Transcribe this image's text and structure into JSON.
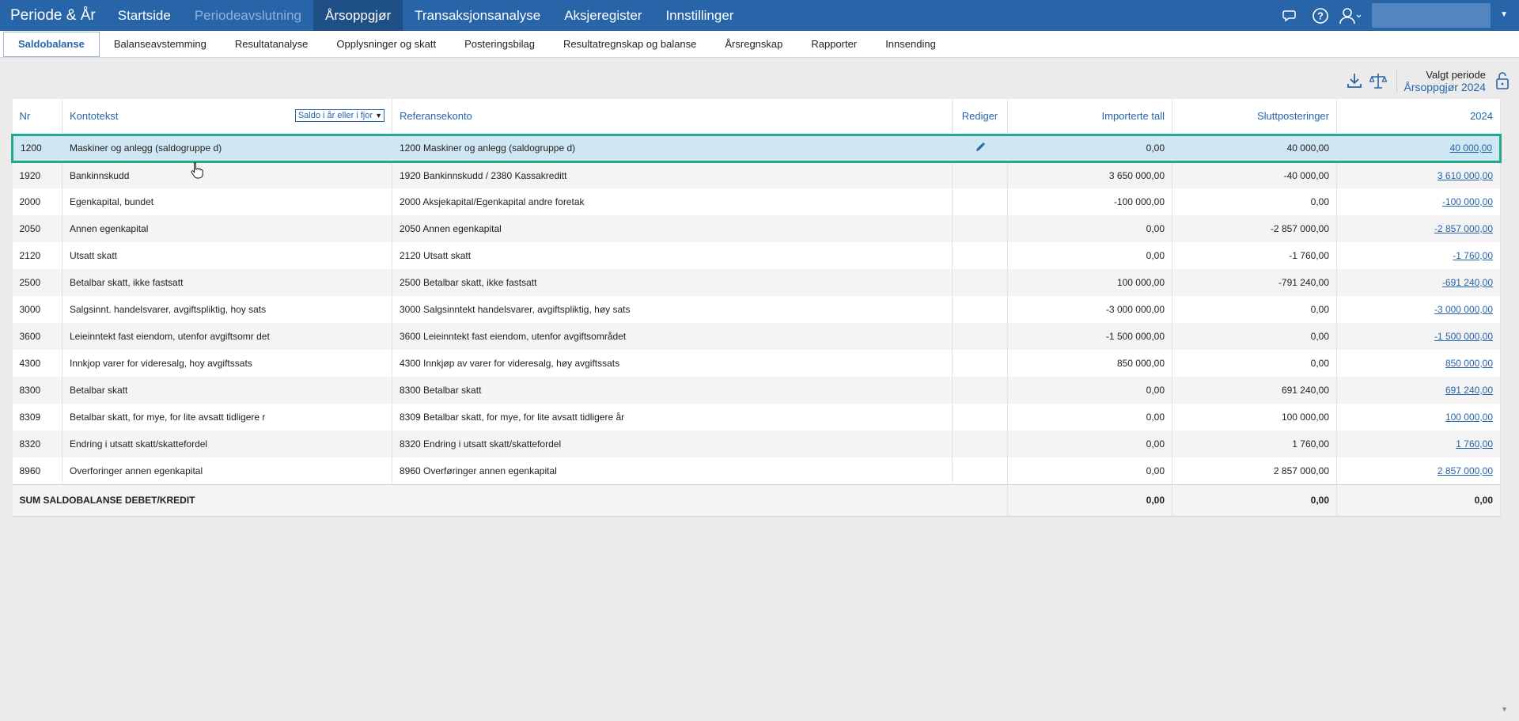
{
  "app": {
    "brand": "Periode & År"
  },
  "topnav": [
    {
      "label": "Startside",
      "state": "normal"
    },
    {
      "label": "Periodeavslutning",
      "state": "disabled"
    },
    {
      "label": "Årsoppgjør",
      "state": "active"
    },
    {
      "label": "Transaksjonsanalyse",
      "state": "normal"
    },
    {
      "label": "Aksjeregister",
      "state": "normal"
    },
    {
      "label": "Innstillinger",
      "state": "normal"
    }
  ],
  "topright_icons": [
    "chat-icon",
    "help-icon",
    "user-icon"
  ],
  "subtabs": [
    {
      "label": "Saldobalanse",
      "active": true
    },
    {
      "label": "Balanseavstemming",
      "active": false
    },
    {
      "label": "Resultatanalyse",
      "active": false
    },
    {
      "label": "Opplysninger og skatt",
      "active": false
    },
    {
      "label": "Posteringsbilag",
      "active": false
    },
    {
      "label": "Resultatregnskap og balanse",
      "active": false
    },
    {
      "label": "Årsregnskap",
      "active": false
    },
    {
      "label": "Rapporter",
      "active": false
    },
    {
      "label": "Innsending",
      "active": false
    }
  ],
  "period": {
    "label": "Valgt periode",
    "value": "Årsoppgjør 2024"
  },
  "table": {
    "headers": {
      "nr": "Nr",
      "kontotekst": "Kontotekst",
      "filter": "Saldo i år eller i fjor",
      "referansekonto": "Referansekonto",
      "rediger": "Rediger",
      "importerte": "Importerte tall",
      "slutt": "Sluttposteringer",
      "year": "2024"
    },
    "rows": [
      {
        "nr": "1200",
        "text": "Maskiner og anlegg (saldogruppe d)",
        "ref": "1200 Maskiner og anlegg (saldogruppe d)",
        "imp": "0,00",
        "slutt": "40 000,00",
        "total": "40 000,00",
        "selected": true
      },
      {
        "nr": "1920",
        "text": "Bankinnskudd",
        "ref": "1920 Bankinnskudd / 2380 Kassakreditt",
        "imp": "3 650 000,00",
        "slutt": "-40 000,00",
        "total": "3 610 000,00"
      },
      {
        "nr": "2000",
        "text": "Egenkapital, bundet",
        "ref": "2000 Aksjekapital/Egenkapital andre foretak",
        "imp": "-100 000,00",
        "slutt": "0,00",
        "total": "-100 000,00"
      },
      {
        "nr": "2050",
        "text": "Annen egenkapital",
        "ref": "2050 Annen egenkapital",
        "imp": "0,00",
        "slutt": "-2 857 000,00",
        "total": "-2 857 000,00"
      },
      {
        "nr": "2120",
        "text": "Utsatt skatt",
        "ref": "2120 Utsatt skatt",
        "imp": "0,00",
        "slutt": "-1 760,00",
        "total": "-1 760,00"
      },
      {
        "nr": "2500",
        "text": "Betalbar skatt, ikke fastsatt",
        "ref": "2500 Betalbar skatt, ikke fastsatt",
        "imp": "100 000,00",
        "slutt": "-791 240,00",
        "total": "-691 240,00"
      },
      {
        "nr": "3000",
        "text": "Salgsinnt. handelsvarer, avgiftspliktig, hoy sats",
        "ref": "3000 Salgsinntekt handelsvarer, avgiftspliktig, høy sats",
        "imp": "-3 000 000,00",
        "slutt": "0,00",
        "total": "-3 000 000,00"
      },
      {
        "nr": "3600",
        "text": "Leieinntekt fast eiendom, utenfor avgiftsomr det",
        "ref": "3600 Leieinntekt fast eiendom, utenfor avgiftsområdet",
        "imp": "-1 500 000,00",
        "slutt": "0,00",
        "total": "-1 500 000,00"
      },
      {
        "nr": "4300",
        "text": "Innkjop varer for videresalg, hoy avgiftssats",
        "ref": "4300 Innkjøp av varer for videresalg, høy avgiftssats",
        "imp": "850 000,00",
        "slutt": "0,00",
        "total": "850 000,00"
      },
      {
        "nr": "8300",
        "text": "Betalbar skatt",
        "ref": "8300 Betalbar skatt",
        "imp": "0,00",
        "slutt": "691 240,00",
        "total": "691 240,00"
      },
      {
        "nr": "8309",
        "text": "Betalbar skatt, for mye, for lite avsatt tidligere r",
        "ref": "8309 Betalbar skatt, for mye, for lite avsatt tidligere år",
        "imp": "0,00",
        "slutt": "100 000,00",
        "total": "100 000,00"
      },
      {
        "nr": "8320",
        "text": "Endring i utsatt skatt/skattefordel",
        "ref": "8320 Endring i utsatt skatt/skattefordel",
        "imp": "0,00",
        "slutt": "1 760,00",
        "total": "1 760,00"
      },
      {
        "nr": "8960",
        "text": "Overforinger annen egenkapital",
        "ref": "8960 Overføringer annen egenkapital",
        "imp": "0,00",
        "slutt": "2 857 000,00",
        "total": "2 857 000,00"
      }
    ],
    "footer": {
      "label": "SUM SALDOBALANSE DEBET/KREDIT",
      "imp": "0,00",
      "slutt": "0,00",
      "total": "0,00"
    }
  },
  "colors": {
    "nav": "#2765a8",
    "accent": "#2765a8",
    "selection_border": "#22a88d",
    "selection_bg": "#cfe6f3"
  }
}
